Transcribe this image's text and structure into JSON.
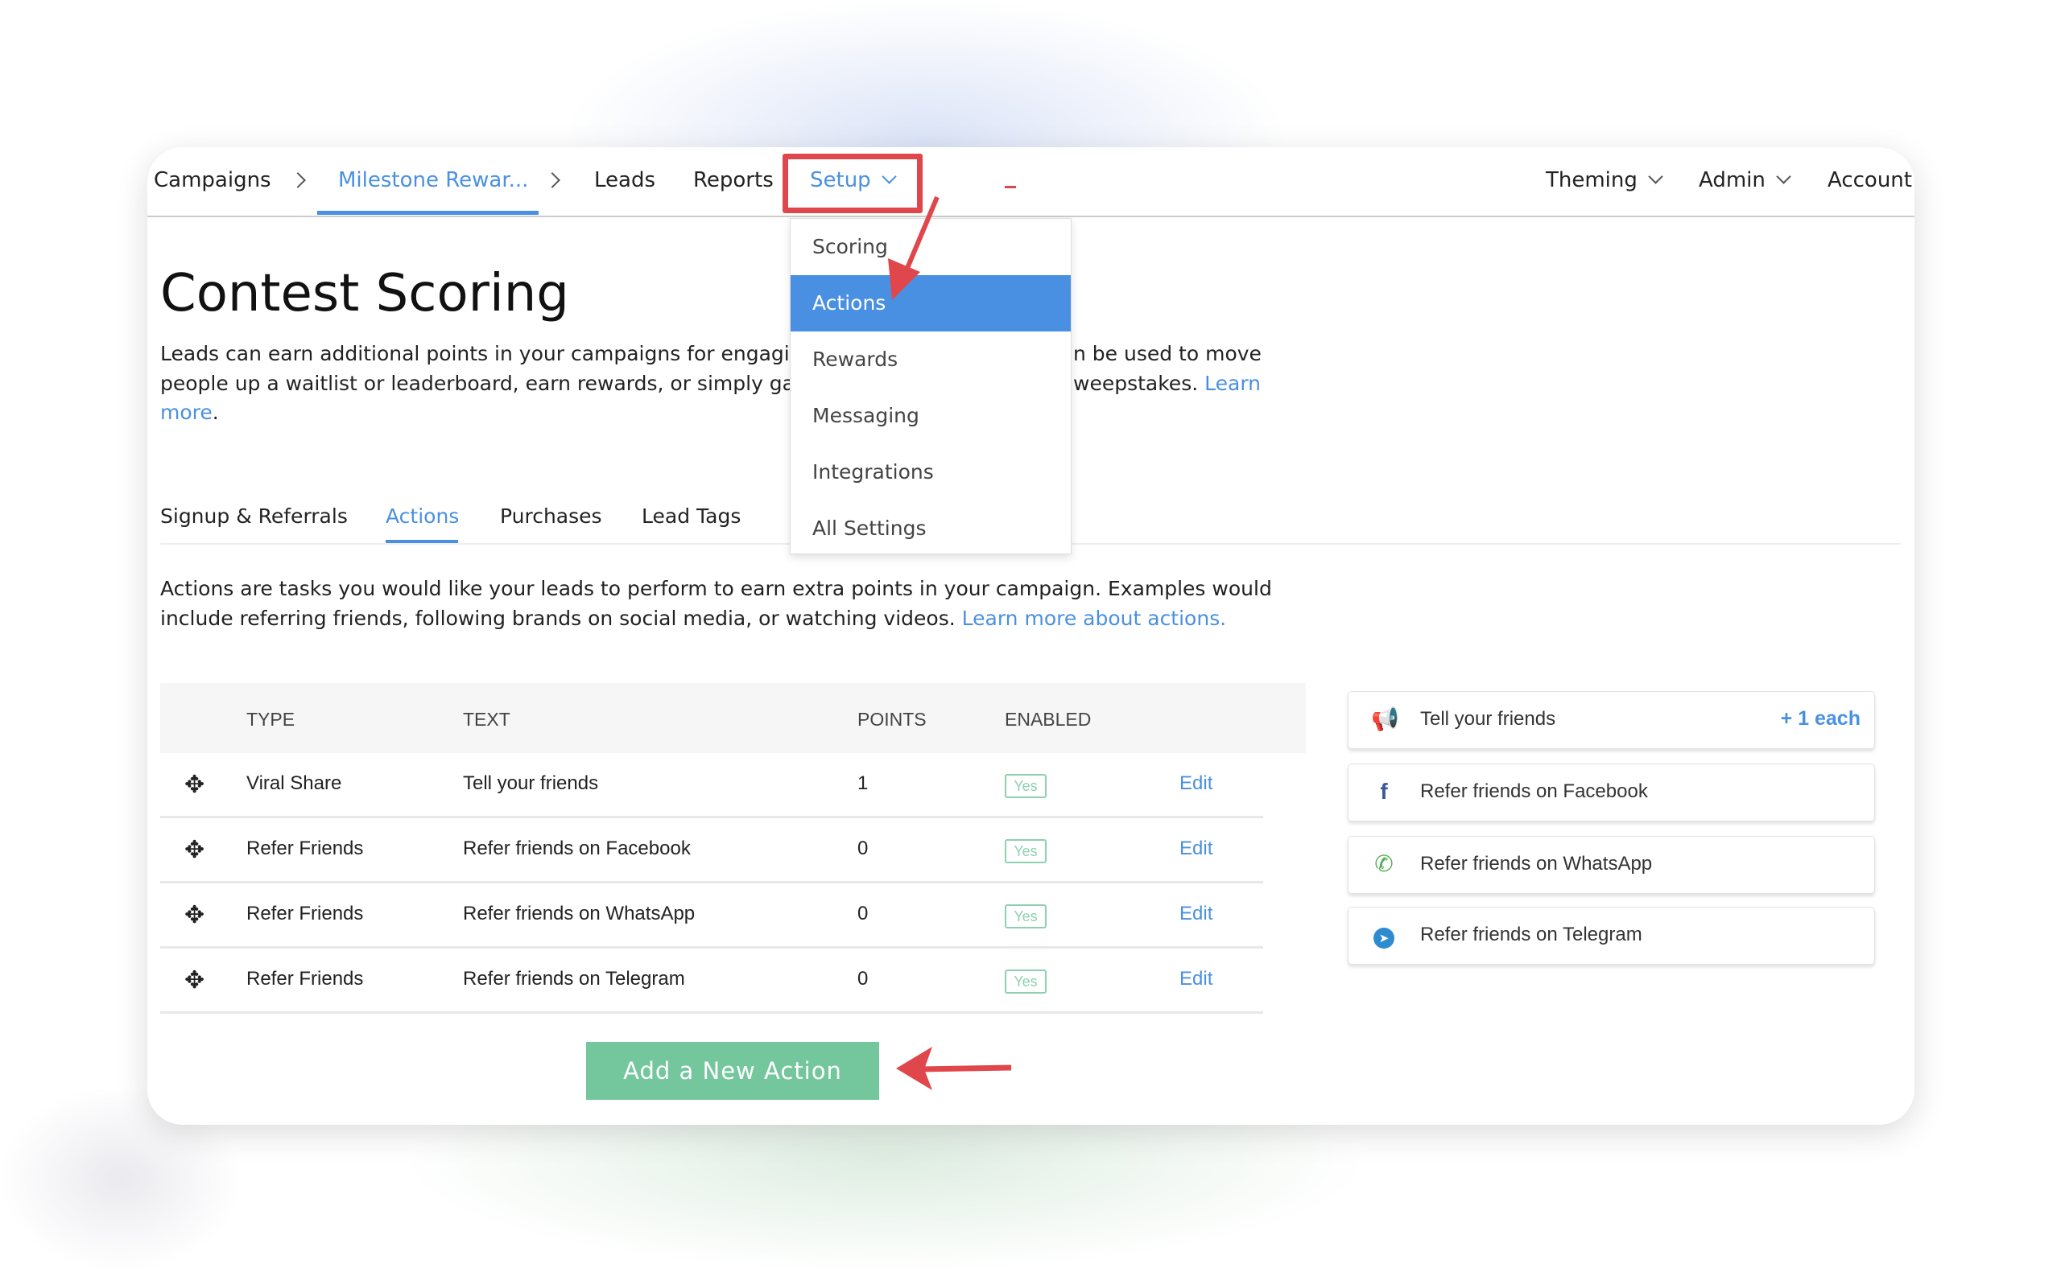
{
  "nav": {
    "items": [
      "Campaigns",
      "Milestone Rewar...",
      "Leads",
      "Reports",
      "Setup"
    ],
    "right": [
      "Theming",
      "Admin",
      "Account"
    ]
  },
  "setup_menu": {
    "items": [
      "Scoring",
      "Actions",
      "Rewards",
      "Messaging",
      "Integrations",
      "All Settings"
    ],
    "active": "Actions"
  },
  "page": {
    "title": "Contest Scoring",
    "intro_line1_a": "Leads can earn additional points in your campaigns for engagin",
    "intro_line1_b": "n be used to move",
    "intro_line2_a": "people up a waitlist or leaderboard, earn rewards, or simply gai",
    "intro_line2_b": "weepstakes.",
    "intro_link_a": "Learn",
    "intro_link_b": "more",
    "intro_end": "."
  },
  "tabs": [
    "Signup & Referrals",
    "Actions",
    "Purchases",
    "Lead Tags"
  ],
  "actions_section": {
    "line1": "Actions are tasks you would like your leads to perform to earn extra points in your campaign. Examples would",
    "line2": "include referring friends, following brands on social media, or watching videos.",
    "link": "Learn more about actions."
  },
  "table": {
    "headers": [
      "TYPE",
      "TEXT",
      "POINTS",
      "ENABLED"
    ],
    "rows": [
      {
        "type": "Viral Share",
        "text": "Tell your friends",
        "points": "1",
        "enabled": "Yes",
        "action": "Edit"
      },
      {
        "type": "Refer Friends",
        "text": "Refer friends on Facebook",
        "points": "0",
        "enabled": "Yes",
        "action": "Edit"
      },
      {
        "type": "Refer Friends",
        "text": "Refer friends on WhatsApp",
        "points": "0",
        "enabled": "Yes",
        "action": "Edit"
      },
      {
        "type": "Refer Friends",
        "text": "Refer friends on Telegram",
        "points": "0",
        "enabled": "Yes",
        "action": "Edit"
      }
    ]
  },
  "add_button": "Add a New Action",
  "preview": [
    {
      "icon": "megaphone-icon",
      "text": "Tell your friends",
      "points": "+ 1 each"
    },
    {
      "icon": "facebook-icon",
      "text": "Refer friends on Facebook"
    },
    {
      "icon": "whatsapp-icon",
      "text": "Refer friends on WhatsApp"
    },
    {
      "icon": "telegram-icon",
      "text": "Refer friends on Telegram"
    }
  ],
  "colors": {
    "accent": "#4a90e2",
    "button": "#74c69d",
    "annotation": "#e0474c",
    "enabled": "#8fd0b0"
  }
}
